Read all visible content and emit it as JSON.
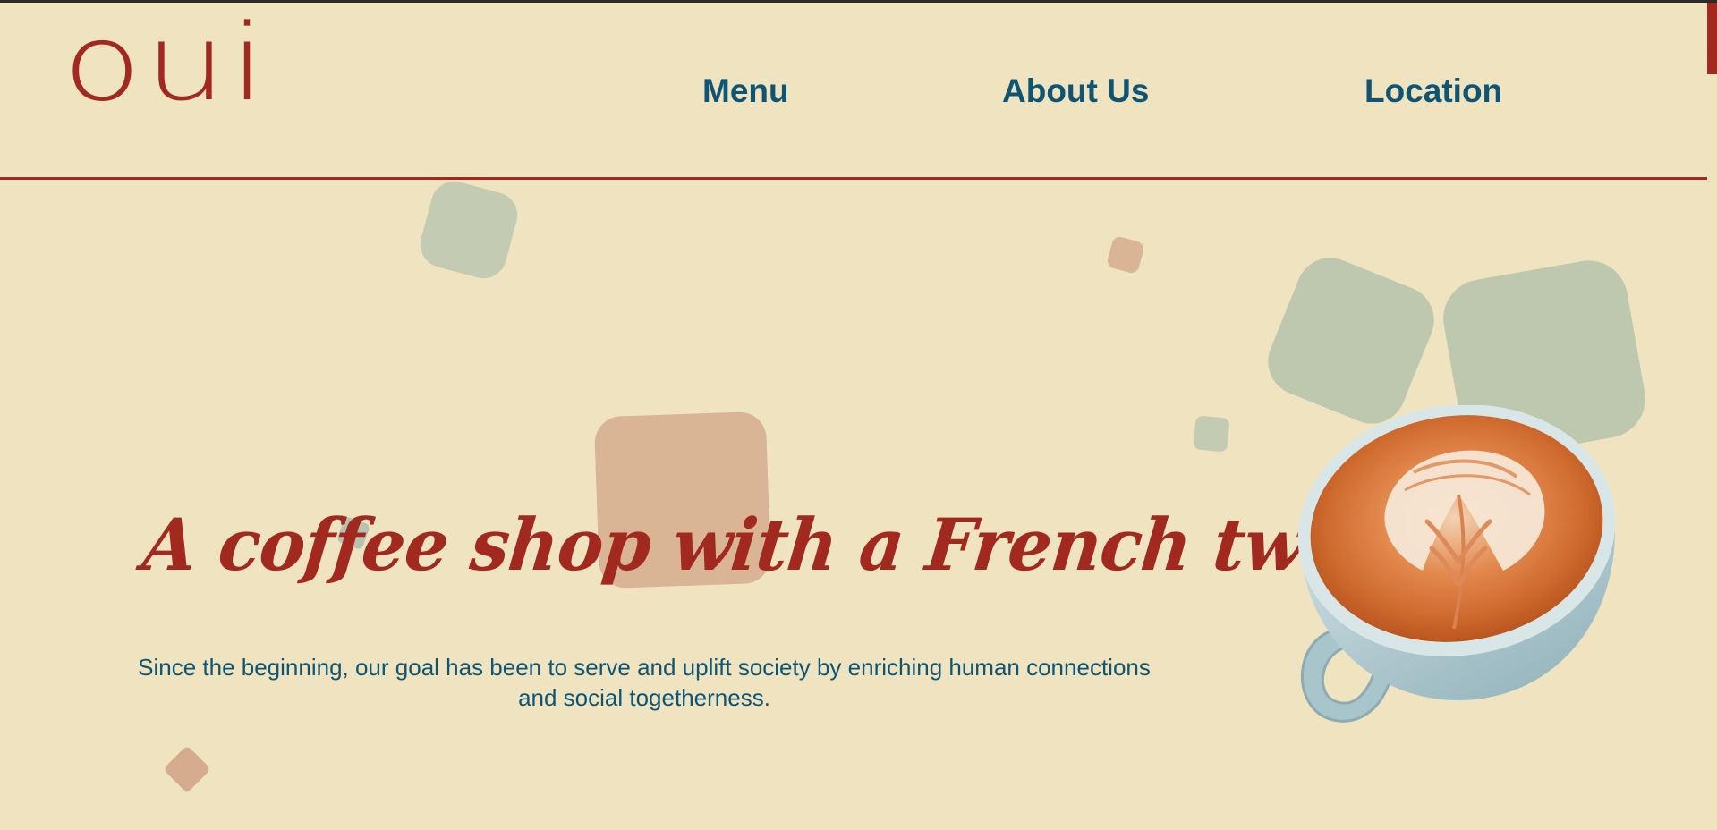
{
  "header": {
    "logo_text": "oui"
  },
  "nav": {
    "items": [
      {
        "label": "Menu"
      },
      {
        "label": "About Us"
      },
      {
        "label": "Location"
      }
    ]
  },
  "hero": {
    "title": "A coffee shop with a French twist!",
    "subtitle": "Since the beginning, our goal has been to serve and uplift society by enriching human connections and social togetherness."
  },
  "colors": {
    "background": "#efe4bf",
    "brand_red": "#a2291f",
    "nav_blue": "#0e5575",
    "sage": "#c3ccb2",
    "tan": "#d9b595"
  },
  "images": {
    "hero_image": "latte-art-cup"
  }
}
